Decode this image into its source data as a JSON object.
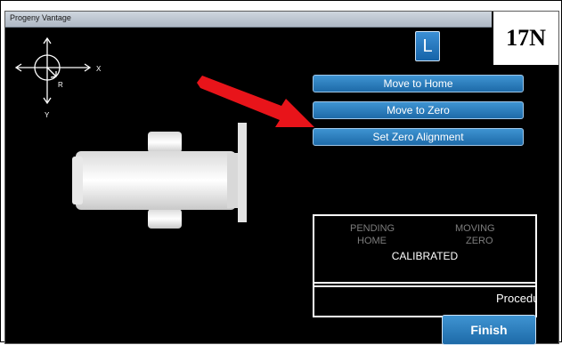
{
  "window": {
    "title": "Progeny Vantage"
  },
  "badge": {
    "label": "17N"
  },
  "side_button": {
    "label": "L"
  },
  "axis": {
    "x_label": "X",
    "y_label": "Y",
    "r_label": "R"
  },
  "actions": [
    {
      "label": "Move to Home"
    },
    {
      "label": "Move to Zero"
    },
    {
      "label": "Set Zero Alignment"
    }
  ],
  "status": {
    "pending": "PENDING",
    "moving": "MOVING",
    "home": "HOME",
    "zero": "ZERO",
    "calibrated": "CALIBRATED"
  },
  "procedure": {
    "text": "Procedure"
  },
  "finish": {
    "label": "Finish"
  },
  "colors": {
    "button_blue": "#1d6aa8",
    "screen_bg": "#000000",
    "arrow_red": "#e8141a",
    "status_inactive": "#7d7d7d"
  }
}
